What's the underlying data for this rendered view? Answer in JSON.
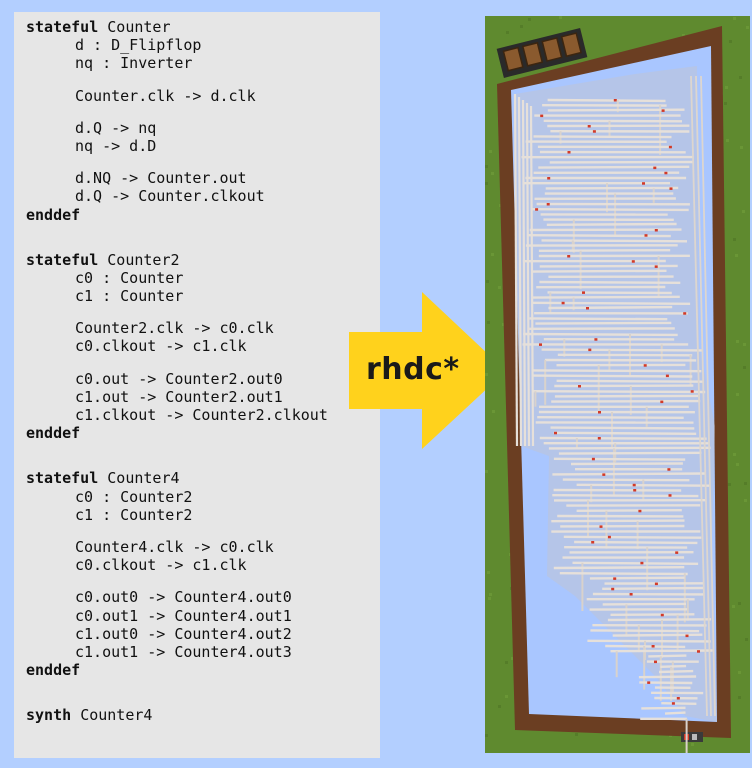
{
  "code": {
    "blocks": [
      {
        "keyword": "stateful",
        "name": "Counter",
        "groups": [
          [
            "d : D_Flipflop",
            "nq : Inverter"
          ],
          [
            "Counter.clk -> d.clk"
          ],
          [
            "d.Q -> nq",
            "nq -> d.D"
          ],
          [
            "d.NQ -> Counter.out",
            "d.Q -> Counter.clkout"
          ]
        ],
        "end": "enddef"
      },
      {
        "keyword": "stateful",
        "name": "Counter2",
        "groups": [
          [
            "c0 : Counter",
            "c1 : Counter"
          ],
          [
            "Counter2.clk -> c0.clk",
            "c0.clkout -> c1.clk"
          ],
          [
            "c0.out -> Counter2.out0",
            "c1.out -> Counter2.out1",
            "c1.clkout -> Counter2.clkout"
          ]
        ],
        "end": "enddef"
      },
      {
        "keyword": "stateful",
        "name": "Counter4",
        "groups": [
          [
            "c0 : Counter2",
            "c1 : Counter2"
          ],
          [
            "Counter4.clk -> c0.clk",
            "c0.clkout -> c1.clk"
          ],
          [
            "c0.out0 -> Counter4.out0",
            "c0.out1 -> Counter4.out1",
            "c1.out0 -> Counter4.out2",
            "c1.out1 -> Counter4.out3"
          ]
        ],
        "end": "enddef"
      }
    ],
    "synth": {
      "keyword": "synth",
      "target": "Counter4"
    }
  },
  "arrow": {
    "label": "rhdc*",
    "color": "#ffd21c"
  },
  "colors": {
    "background": "#b3cfff",
    "code_panel": "#e6e6e6",
    "grass": "#5f8a2f",
    "wood_frame": "#6b3e22",
    "sky": "#a9c6ff",
    "circuit": "#e6e0da",
    "redstone": "#d23a28"
  }
}
